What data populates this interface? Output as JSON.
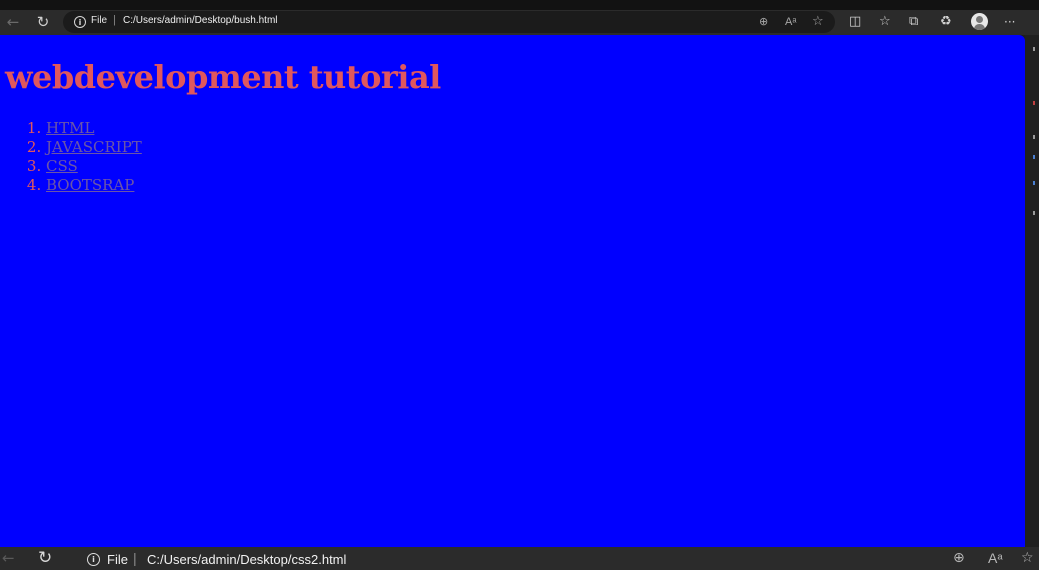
{
  "browser": {
    "icons": {
      "back": "arrow-left-icon",
      "reload": "reload-icon",
      "site_info": "info-icon",
      "zoom": "zoom-in-icon",
      "read_aloud": "read-aloud-icon",
      "favorite": "star-icon",
      "split_screen": "split-screen-icon",
      "favorites": "favorites-list-icon",
      "collections": "collections-icon",
      "extensions": "extensions-icon",
      "profile": "profile-avatar-icon",
      "more": "more-icon"
    },
    "address": {
      "scheme_label": "File",
      "separator": "|",
      "url": "C:/Users/admin/Desktop/bush.html"
    },
    "more_label": "···",
    "read_aloud_label": "Áʰ"
  },
  "page": {
    "background_color": "#0000ff",
    "heading": "webdevelopment tutorial",
    "heading_color": "#e0575d",
    "list": [
      {
        "number": "1.",
        "label": "HTML"
      },
      {
        "number": "2.",
        "label": "JAVASCRIPT"
      },
      {
        "number": "3.",
        "label": "CSS"
      },
      {
        "number": "4.",
        "label": "BOOTSRAP"
      }
    ],
    "link_color": "#6b56a8"
  },
  "second_window": {
    "address": {
      "scheme_label": "File",
      "separator": "|",
      "url": "C:/Users/admin/Desktop/css2.html"
    },
    "read_aloud_label": "Aʰ"
  }
}
